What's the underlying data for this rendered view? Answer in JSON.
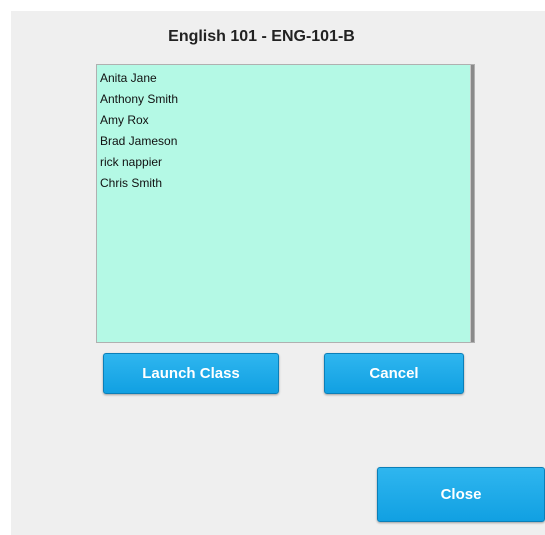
{
  "dialog": {
    "title": "English 101 - ENG-101-B"
  },
  "students": [
    "Anita Jane",
    "Anthony Smith",
    "Amy Rox",
    "Brad Jameson",
    "rick nappier",
    "Chris Smith"
  ],
  "buttons": {
    "launch_label": "Launch Class",
    "cancel_label": "Cancel",
    "close_label": "Close"
  },
  "colors": {
    "list_background": "#b4f9e5",
    "button_primary": "#1aa7e8",
    "dialog_background": "#efefef"
  }
}
